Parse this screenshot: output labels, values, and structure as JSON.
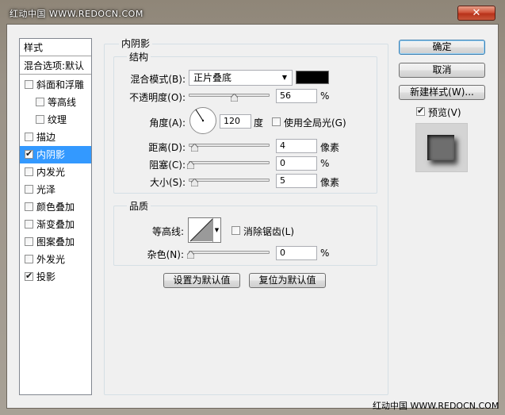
{
  "window": {
    "title": "红动中国 WWW.REDOCN.COM",
    "close_glyph": "✕"
  },
  "styles_panel": {
    "title": "样式",
    "blend_options": "混合选项:默认",
    "items": [
      {
        "label": "斜面和浮雕",
        "checked": false
      },
      {
        "label": "等高线",
        "checked": false
      },
      {
        "label": "纹理",
        "checked": false
      },
      {
        "label": "描边",
        "checked": false
      },
      {
        "label": "内阴影",
        "checked": true,
        "selected": true
      },
      {
        "label": "内发光",
        "checked": false
      },
      {
        "label": "光泽",
        "checked": false
      },
      {
        "label": "颜色叠加",
        "checked": false
      },
      {
        "label": "渐变叠加",
        "checked": false
      },
      {
        "label": "图案叠加",
        "checked": false
      },
      {
        "label": "外发光",
        "checked": false
      },
      {
        "label": "投影",
        "checked": true
      }
    ]
  },
  "inner_shadow": {
    "section_title": "内阴影",
    "structure": {
      "title": "结构",
      "blend_mode_label": "混合模式(B):",
      "blend_mode_value": "正片叠底",
      "shadow_color": "#000000",
      "opacity_label": "不透明度(O):",
      "opacity_value": "56",
      "opacity_unit": "%",
      "angle_label": "角度(A):",
      "angle_value": "120",
      "angle_unit": "度",
      "global_light_label": "使用全局光(G)",
      "global_light_checked": false,
      "distance_label": "距离(D):",
      "distance_value": "4",
      "distance_unit": "像素",
      "choke_label": "阻塞(C):",
      "choke_value": "0",
      "choke_unit": "%",
      "size_label": "大小(S):",
      "size_value": "5",
      "size_unit": "像素"
    },
    "quality": {
      "title": "品质",
      "contour_label": "等高线:",
      "anti_alias_label": "消除锯齿(L)",
      "anti_alias_checked": false,
      "noise_label": "杂色(N):",
      "noise_value": "0",
      "noise_unit": "%"
    },
    "set_default_button": "设置为默认值",
    "reset_default_button": "复位为默认值"
  },
  "actions": {
    "ok": "确定",
    "cancel": "取消",
    "new_style": "新建样式(W)...",
    "preview_label": "预览(V)",
    "preview_checked": true
  },
  "watermark": "红动中国 WWW.REDOCN.COM"
}
